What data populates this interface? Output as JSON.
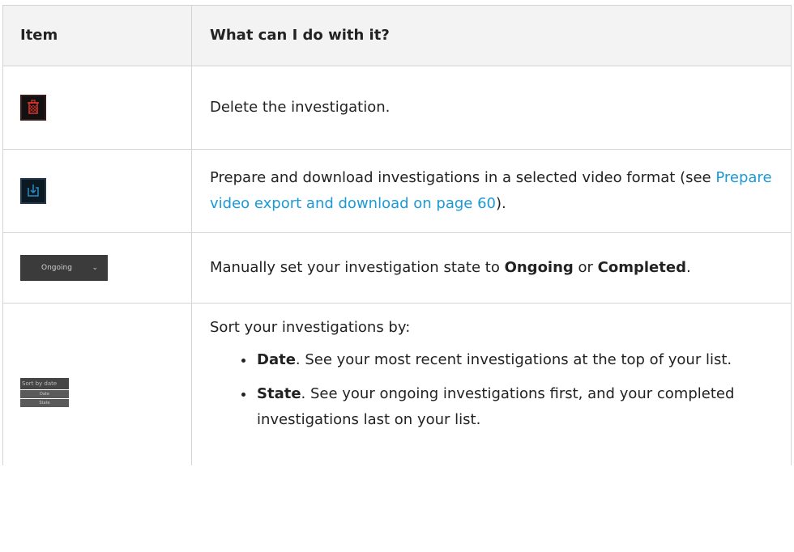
{
  "table": {
    "headers": {
      "item": "Item",
      "description": "What can I do with it?"
    },
    "rows": [
      {
        "icon": "trash-icon",
        "text": "Delete the investigation."
      },
      {
        "icon": "download-icon",
        "text_before": "Prepare and download investigations in a selected video format (see ",
        "link": "Prepare video export and download on page 60",
        "text_after": ")."
      },
      {
        "icon": "state-dropdown",
        "icon_label": "Ongoing",
        "text_before": "Manually set your investigation state to ",
        "bold1": "Ongoing",
        "text_mid": " or ",
        "bold2": "Completed",
        "text_after": "."
      },
      {
        "icon": "sort-dropdown",
        "icon_label": "Sort by date",
        "icon_options": [
          "Date",
          "State"
        ],
        "intro": "Sort your investigations by:",
        "bullets": [
          {
            "bold": "Date",
            "text": ". See your most recent investigations at the top of your list."
          },
          {
            "bold": "State",
            "text": ". See your ongoing investigations first, and your completed investigations last on your list."
          }
        ]
      }
    ]
  },
  "colors": {
    "link": "#1a9ad6",
    "header_bg": "#f3f3f3",
    "border": "#d4d4d4",
    "trash_icon": "#e0342c",
    "download_icon": "#2a8bc4"
  }
}
